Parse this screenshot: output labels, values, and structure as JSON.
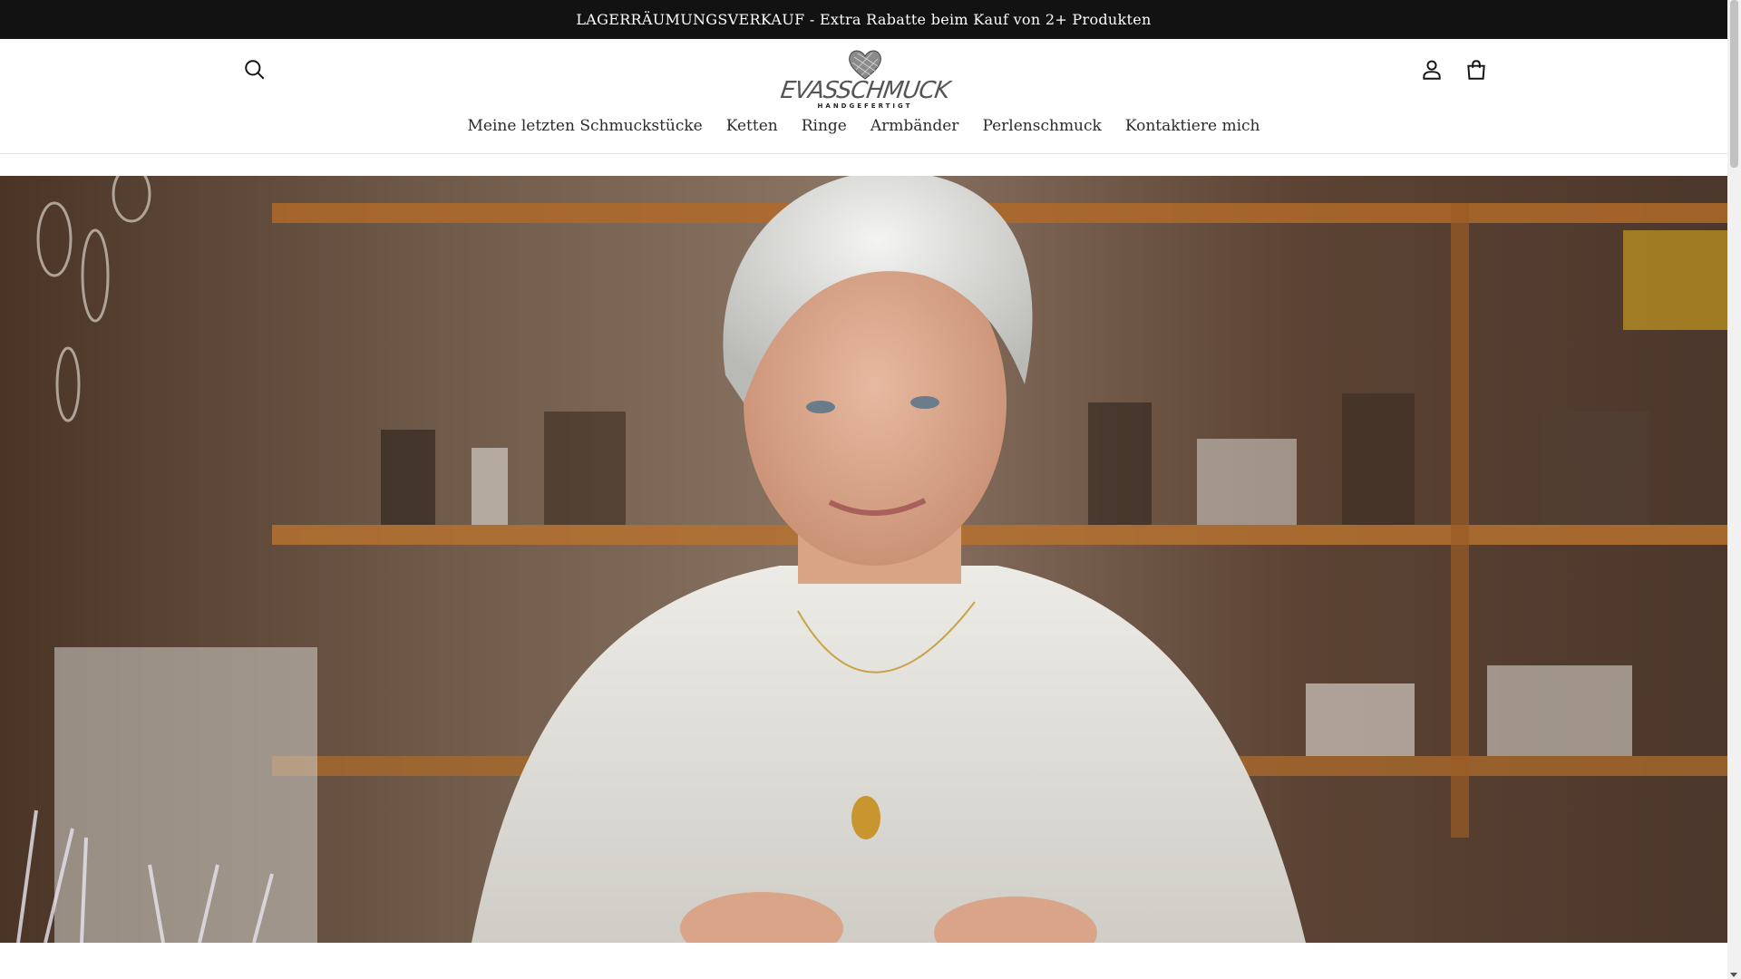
{
  "announcement": {
    "text": "LAGERRÄUMUNGSVERKAUF - Extra Rabatte beim Kauf von 2+ Produkten"
  },
  "header": {
    "logo": {
      "word": "EVASSCHMUCK",
      "subtitle": "HANDGEFERTIGT"
    },
    "icons": {
      "search": "search-icon",
      "account": "account-icon",
      "cart": "cart-icon"
    }
  },
  "nav": {
    "items": [
      {
        "label": "Meine letzten Schmuckstücke"
      },
      {
        "label": "Ketten"
      },
      {
        "label": "Ringe"
      },
      {
        "label": "Armbänder"
      },
      {
        "label": "Perlenschmuck"
      },
      {
        "label": "Kontaktiere mich"
      }
    ]
  },
  "colors": {
    "announcement_bg": "#121212",
    "text": "#121212",
    "nav_text": "#2b2b2b"
  }
}
